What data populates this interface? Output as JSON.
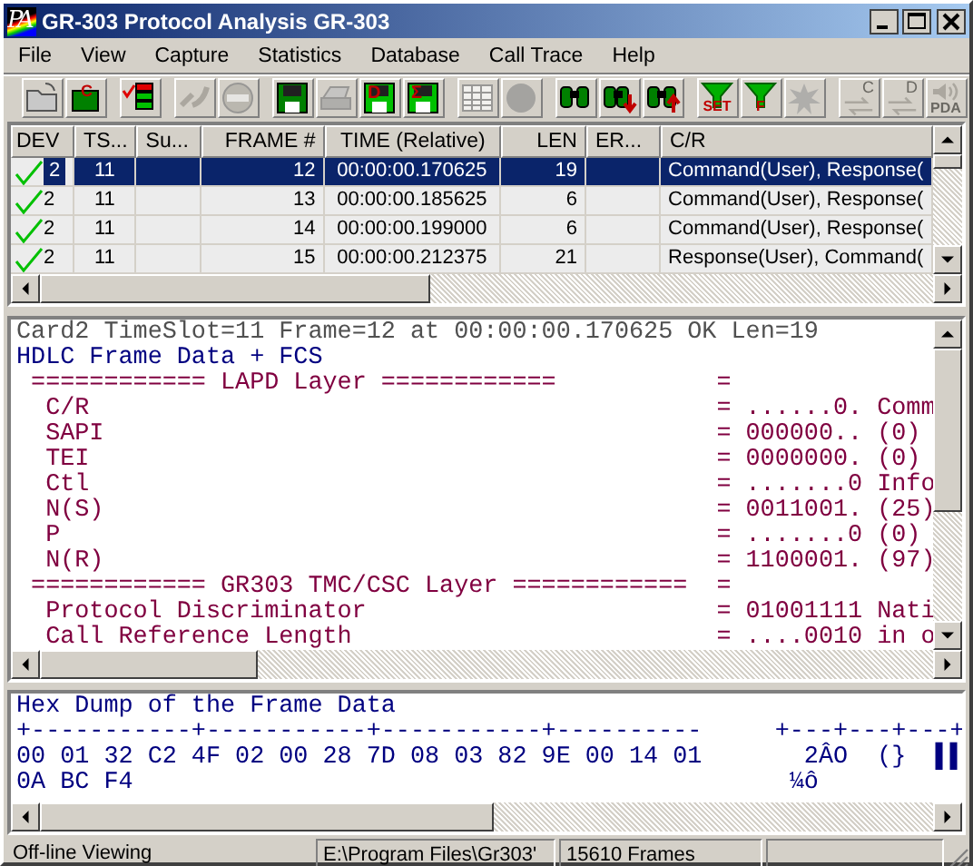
{
  "window": {
    "logo": "PA",
    "title": "GR-303 Protocol Analysis GR-303"
  },
  "menu": [
    {
      "label": "File"
    },
    {
      "label": "View"
    },
    {
      "label": "Capture"
    },
    {
      "label": "Statistics"
    },
    {
      "label": "Database"
    },
    {
      "label": "Call Trace"
    },
    {
      "label": "Help"
    }
  ],
  "toolbar": [
    [
      {
        "kind": "folder",
        "disabled": false
      },
      {
        "kind": "box",
        "label": "C",
        "disabled": false
      }
    ],
    [
      {
        "kind": "list",
        "disabled": false
      }
    ],
    [
      {
        "kind": "link",
        "disabled": true
      },
      {
        "kind": "stop",
        "disabled": true
      }
    ],
    [
      {
        "kind": "disk",
        "disabled": false
      },
      {
        "kind": "printer",
        "disabled": true
      },
      {
        "kind": "disk-letter",
        "label": "D",
        "disabled": false
      },
      {
        "kind": "disk-letter",
        "label": "Σ",
        "disabled": false
      }
    ],
    [
      {
        "kind": "grid",
        "disabled": true
      },
      {
        "kind": "circle",
        "disabled": true
      }
    ],
    [
      {
        "kind": "binoculars",
        "disabled": false
      },
      {
        "kind": "binoculars-down",
        "disabled": false
      },
      {
        "kind": "binoculars-up",
        "disabled": false
      }
    ],
    [
      {
        "kind": "funnel",
        "label": "SET",
        "disabled": false
      },
      {
        "kind": "funnel",
        "label": "F",
        "disabled": false
      },
      {
        "kind": "burst",
        "disabled": true
      }
    ],
    [
      {
        "kind": "arrows-letter",
        "label": "C",
        "disabled": true
      },
      {
        "kind": "arrows-letter",
        "label": "D",
        "disabled": true
      },
      {
        "kind": "speaker",
        "label": "PDA",
        "disabled": true
      }
    ]
  ],
  "table": {
    "columns": [
      "DEV",
      "TS...",
      "Su...",
      "FRAME #",
      "TIME (Relative)",
      "LEN",
      "ER...",
      "C/R"
    ],
    "rows": [
      {
        "ok": true,
        "selected": true,
        "cells": [
          "2",
          "11",
          "",
          "12",
          "00:00:00.170625",
          "19",
          "",
          "Command(User), Response("
        ]
      },
      {
        "ok": true,
        "selected": false,
        "cells": [
          "2",
          "11",
          "",
          "13",
          "00:00:00.185625",
          "6",
          "",
          "Command(User), Response("
        ]
      },
      {
        "ok": true,
        "selected": false,
        "cells": [
          "2",
          "11",
          "",
          "14",
          "00:00:00.199000",
          "6",
          "",
          "Command(User), Response("
        ]
      },
      {
        "ok": true,
        "selected": false,
        "cells": [
          "2",
          "11",
          "",
          "15",
          "00:00:00.212375",
          "21",
          "",
          "Response(User), Command("
        ]
      }
    ]
  },
  "detail": [
    {
      "kind": "info",
      "text": "Card2 TimeSlot=11 Frame=12 at 00:00:00.170625 OK Len=19"
    },
    {
      "kind": "frame",
      "text": "HDLC Frame Data + FCS"
    },
    {
      "kind": "section",
      "text": "============ LAPD Layer ============",
      "value": "="
    },
    {
      "kind": "field",
      "text": "C/R",
      "value": "= ......0. Comm"
    },
    {
      "kind": "field",
      "text": "SAPI",
      "value": "= 000000.. (0)"
    },
    {
      "kind": "field",
      "text": "TEI",
      "value": "= 0000000. (0)"
    },
    {
      "kind": "field",
      "text": "Ctl",
      "value": "= .......0 Info"
    },
    {
      "kind": "field",
      "text": "N(S)",
      "value": "= 0011001. (25)"
    },
    {
      "kind": "field",
      "text": "P",
      "value": "= .......0 (0)"
    },
    {
      "kind": "field",
      "text": "N(R)",
      "value": "= 1100001. (97)"
    },
    {
      "kind": "section",
      "text": "============ GR303 TMC/CSC Layer ============",
      "value": "="
    },
    {
      "kind": "field",
      "text": "Protocol Discriminator",
      "value": "= 01001111 Nati"
    },
    {
      "kind": "field",
      "text": "Call Reference Length",
      "value": "= ....0010 in o"
    }
  ],
  "hex": {
    "title": "Hex Dump of the Frame Data",
    "rows": [
      {
        "hex": "+-----------+-----------+-----------+----------",
        "ascii": "+---+---+---+"
      },
      {
        "hex": "00 01 32 C2 4F 02 00 28 7D 08 03 82 9E 00 14 01",
        "ascii": "  2ÂO  (}  ▌▌"
      },
      {
        "hex": "0A BC F4",
        "ascii": " ¼ô"
      }
    ]
  },
  "status_bar": [
    "Off-line Viewing",
    "E:\\Program Files\\Gr303'",
    "15610 Frames"
  ]
}
